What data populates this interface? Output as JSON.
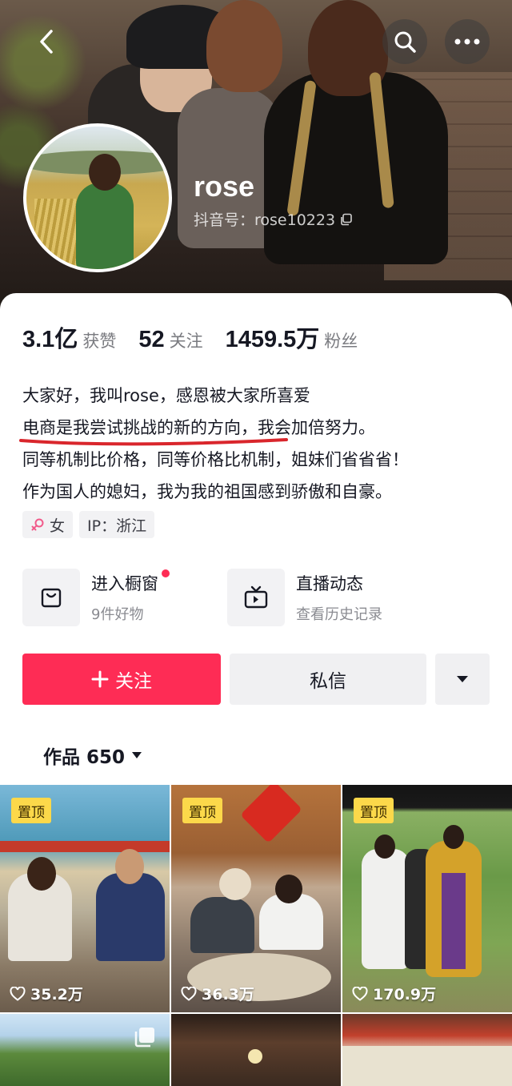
{
  "header": {
    "username": "rose",
    "douyin_id": "抖音号：rose10223"
  },
  "stats": [
    {
      "value": "3.1亿",
      "label": "获赞"
    },
    {
      "value": "52",
      "label": "关注"
    },
    {
      "value": "1459.5万",
      "label": "粉丝"
    }
  ],
  "bio": {
    "lines": [
      "大家好，我叫rose，感恩被大家所喜爱",
      "电商是我尝试挑战的新的方向，我会加倍努力。",
      "同等机制比价格，同等价格比机制，姐妹们省省省！",
      "作为国人的媳妇，我为我的祖国感到骄傲和自豪。"
    ]
  },
  "tags": {
    "gender": "女",
    "ip": "IP：浙江"
  },
  "shortcuts": {
    "shop_title": "进入橱窗",
    "shop_sub": "9件好物",
    "live_title": "直播动态",
    "live_sub": "查看历史记录"
  },
  "actions": {
    "follow": "关注",
    "message": "私信"
  },
  "works_tab": {
    "label": "作品 650"
  },
  "videos": [
    {
      "pinned": "置顶",
      "likes": "35.2万"
    },
    {
      "pinned": "置顶",
      "likes": "36.3万"
    },
    {
      "pinned": "置顶",
      "likes": "170.9万"
    }
  ],
  "colors": {
    "accent": "#fe2c55",
    "pin": "#fcd84a"
  }
}
